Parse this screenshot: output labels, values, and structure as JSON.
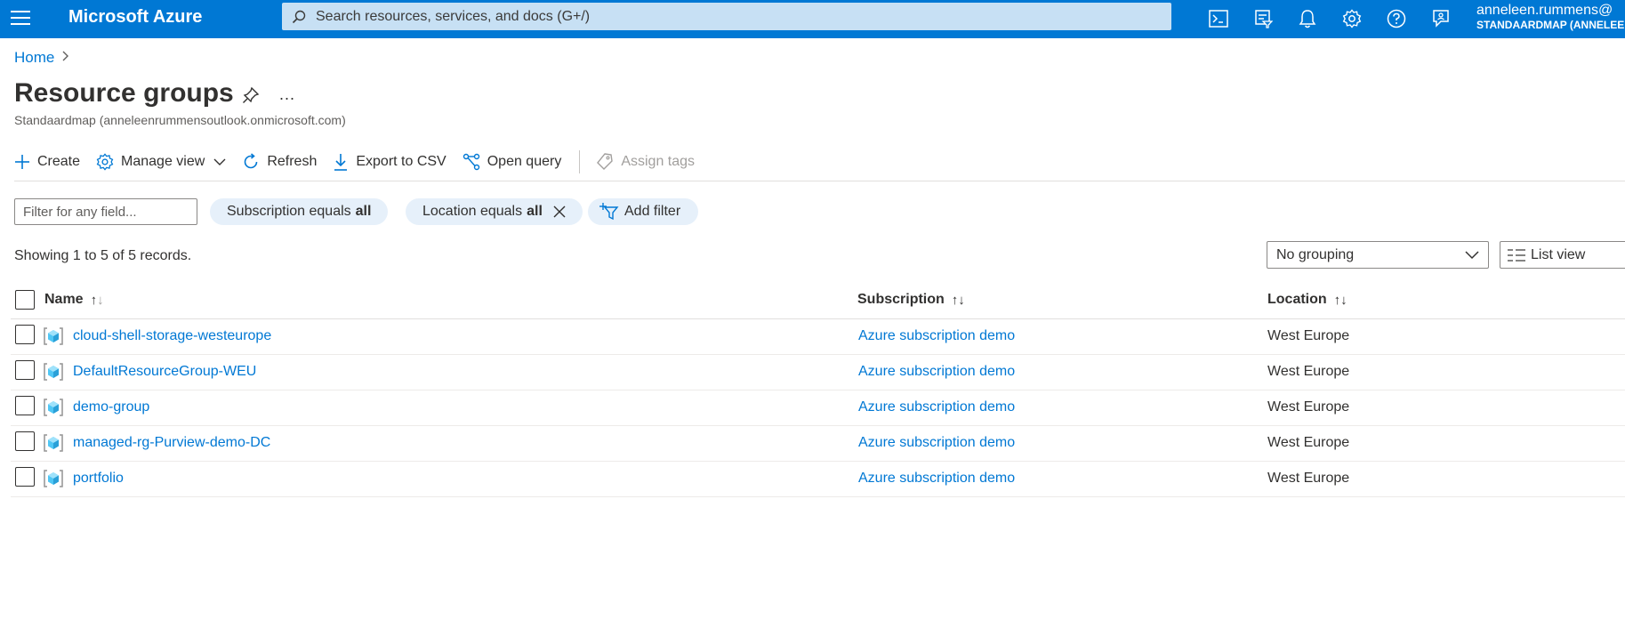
{
  "topbar": {
    "brand": "Microsoft Azure",
    "search_placeholder": "Search resources, services, and docs (G+/)",
    "user_name": "anneleen.rummens@",
    "user_tenant": "STANDAARDMAP (ANNELEEN",
    "icons": [
      "cloud-shell-icon",
      "directory-filter-icon",
      "notifications-icon",
      "settings-icon",
      "help-icon",
      "feedback-icon"
    ]
  },
  "breadcrumb": {
    "home": "Home",
    "separator": ">"
  },
  "page": {
    "title": "Resource groups",
    "more": "...",
    "subtitle": "Standaardmap (anneleenrummensoutlook.onmicrosoft.com)"
  },
  "toolbar": {
    "create": "Create",
    "manage_view": "Manage view",
    "refresh": "Refresh",
    "export_csv": "Export to CSV",
    "open_query": "Open query",
    "assign_tags": "Assign tags"
  },
  "filters": {
    "placeholder": "Filter for any field...",
    "subscription_label": "Subscription equals",
    "subscription_value": "all",
    "location_label": "Location equals",
    "location_value": "all",
    "add_filter": "Add filter"
  },
  "records_text": "Showing 1 to 5 of 5 records.",
  "grouping": "No grouping",
  "view": "List view",
  "table": {
    "columns": {
      "name": "Name",
      "subscription": "Subscription",
      "location": "Location"
    },
    "rows": [
      {
        "name": "cloud-shell-storage-westeurope",
        "subscription": "Azure subscription demo",
        "location": "West Europe"
      },
      {
        "name": "DefaultResourceGroup-WEU",
        "subscription": "Azure subscription demo",
        "location": "West Europe"
      },
      {
        "name": "demo-group",
        "subscription": "Azure subscription demo",
        "location": "West Europe"
      },
      {
        "name": "managed-rg-Purview-demo-DC",
        "subscription": "Azure subscription demo",
        "location": "West Europe"
      },
      {
        "name": "portfolio",
        "subscription": "Azure subscription demo",
        "location": "West Europe"
      }
    ]
  },
  "colors": {
    "azure_blue": "#0078d4",
    "search_bg": "#c7e0f4",
    "pill_bg": "#e6f0fa"
  }
}
